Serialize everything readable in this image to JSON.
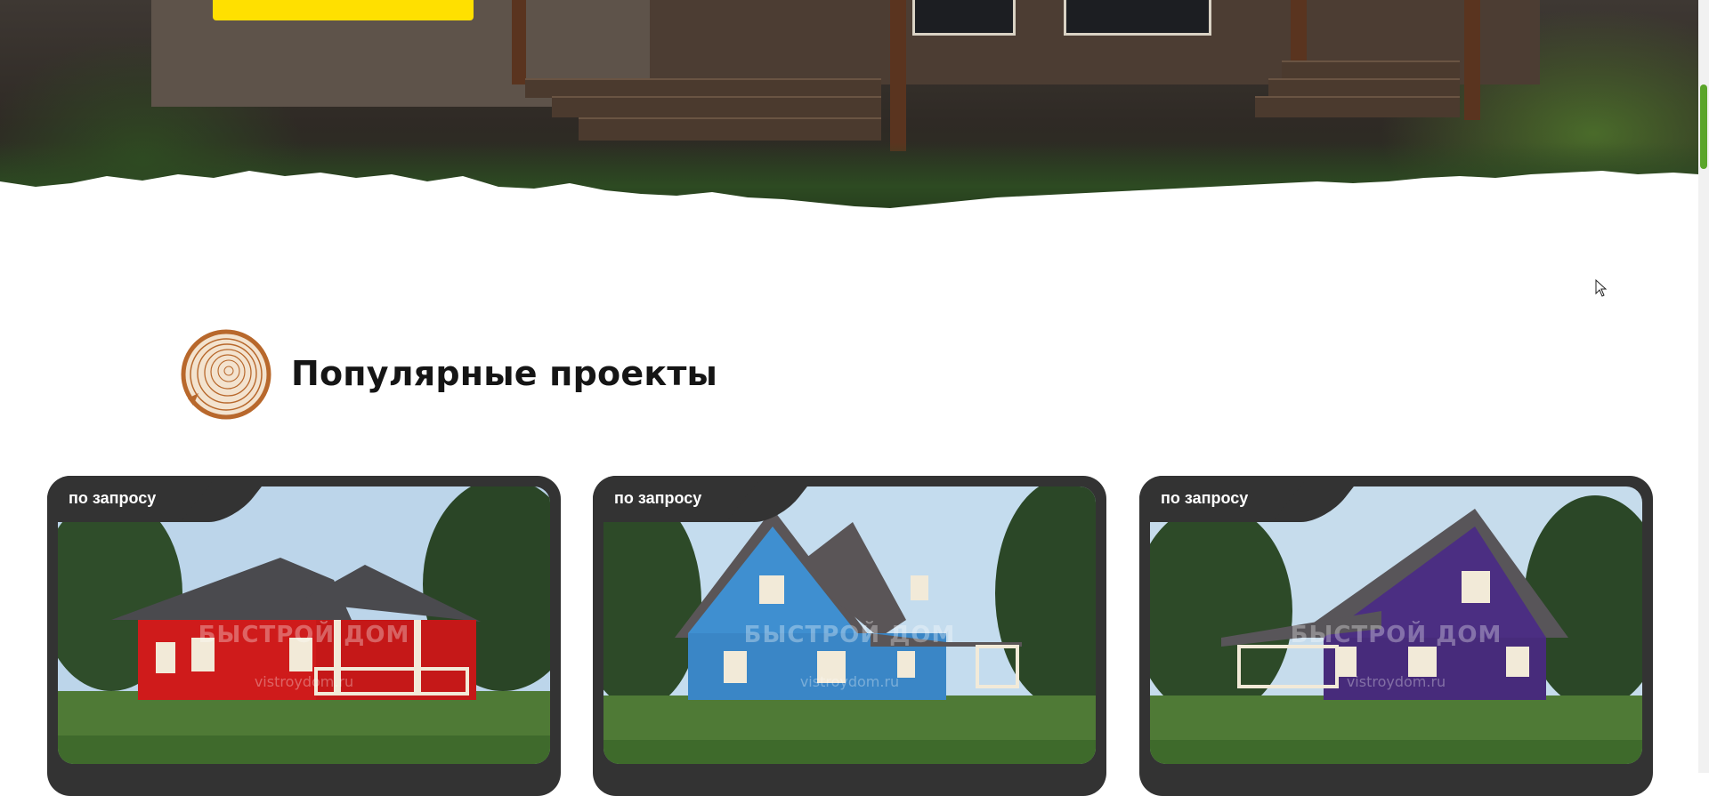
{
  "hero": {
    "cta_color": "#ffe000"
  },
  "section": {
    "title": "Популярные проекты",
    "icon": "log-cross-section-icon"
  },
  "cards": [
    {
      "badge": "по запросу",
      "house_color": "#cf1b1b",
      "watermark": "БЫСТРОЙ ДОМ",
      "watermark_url": "vistroydom.ru"
    },
    {
      "badge": "по запросу",
      "house_color": "#3f8fd0",
      "watermark": "БЫСТРОЙ ДОМ",
      "watermark_url": "vistroydom.ru"
    },
    {
      "badge": "по запросу",
      "house_color": "#4b2e82",
      "watermark": "БЫСТРОЙ ДОМ",
      "watermark_url": "vistroydom.ru"
    }
  ],
  "colors": {
    "accent_yellow": "#ffe000",
    "card_frame": "#333333",
    "scroll_thumb": "#5aa52a"
  }
}
